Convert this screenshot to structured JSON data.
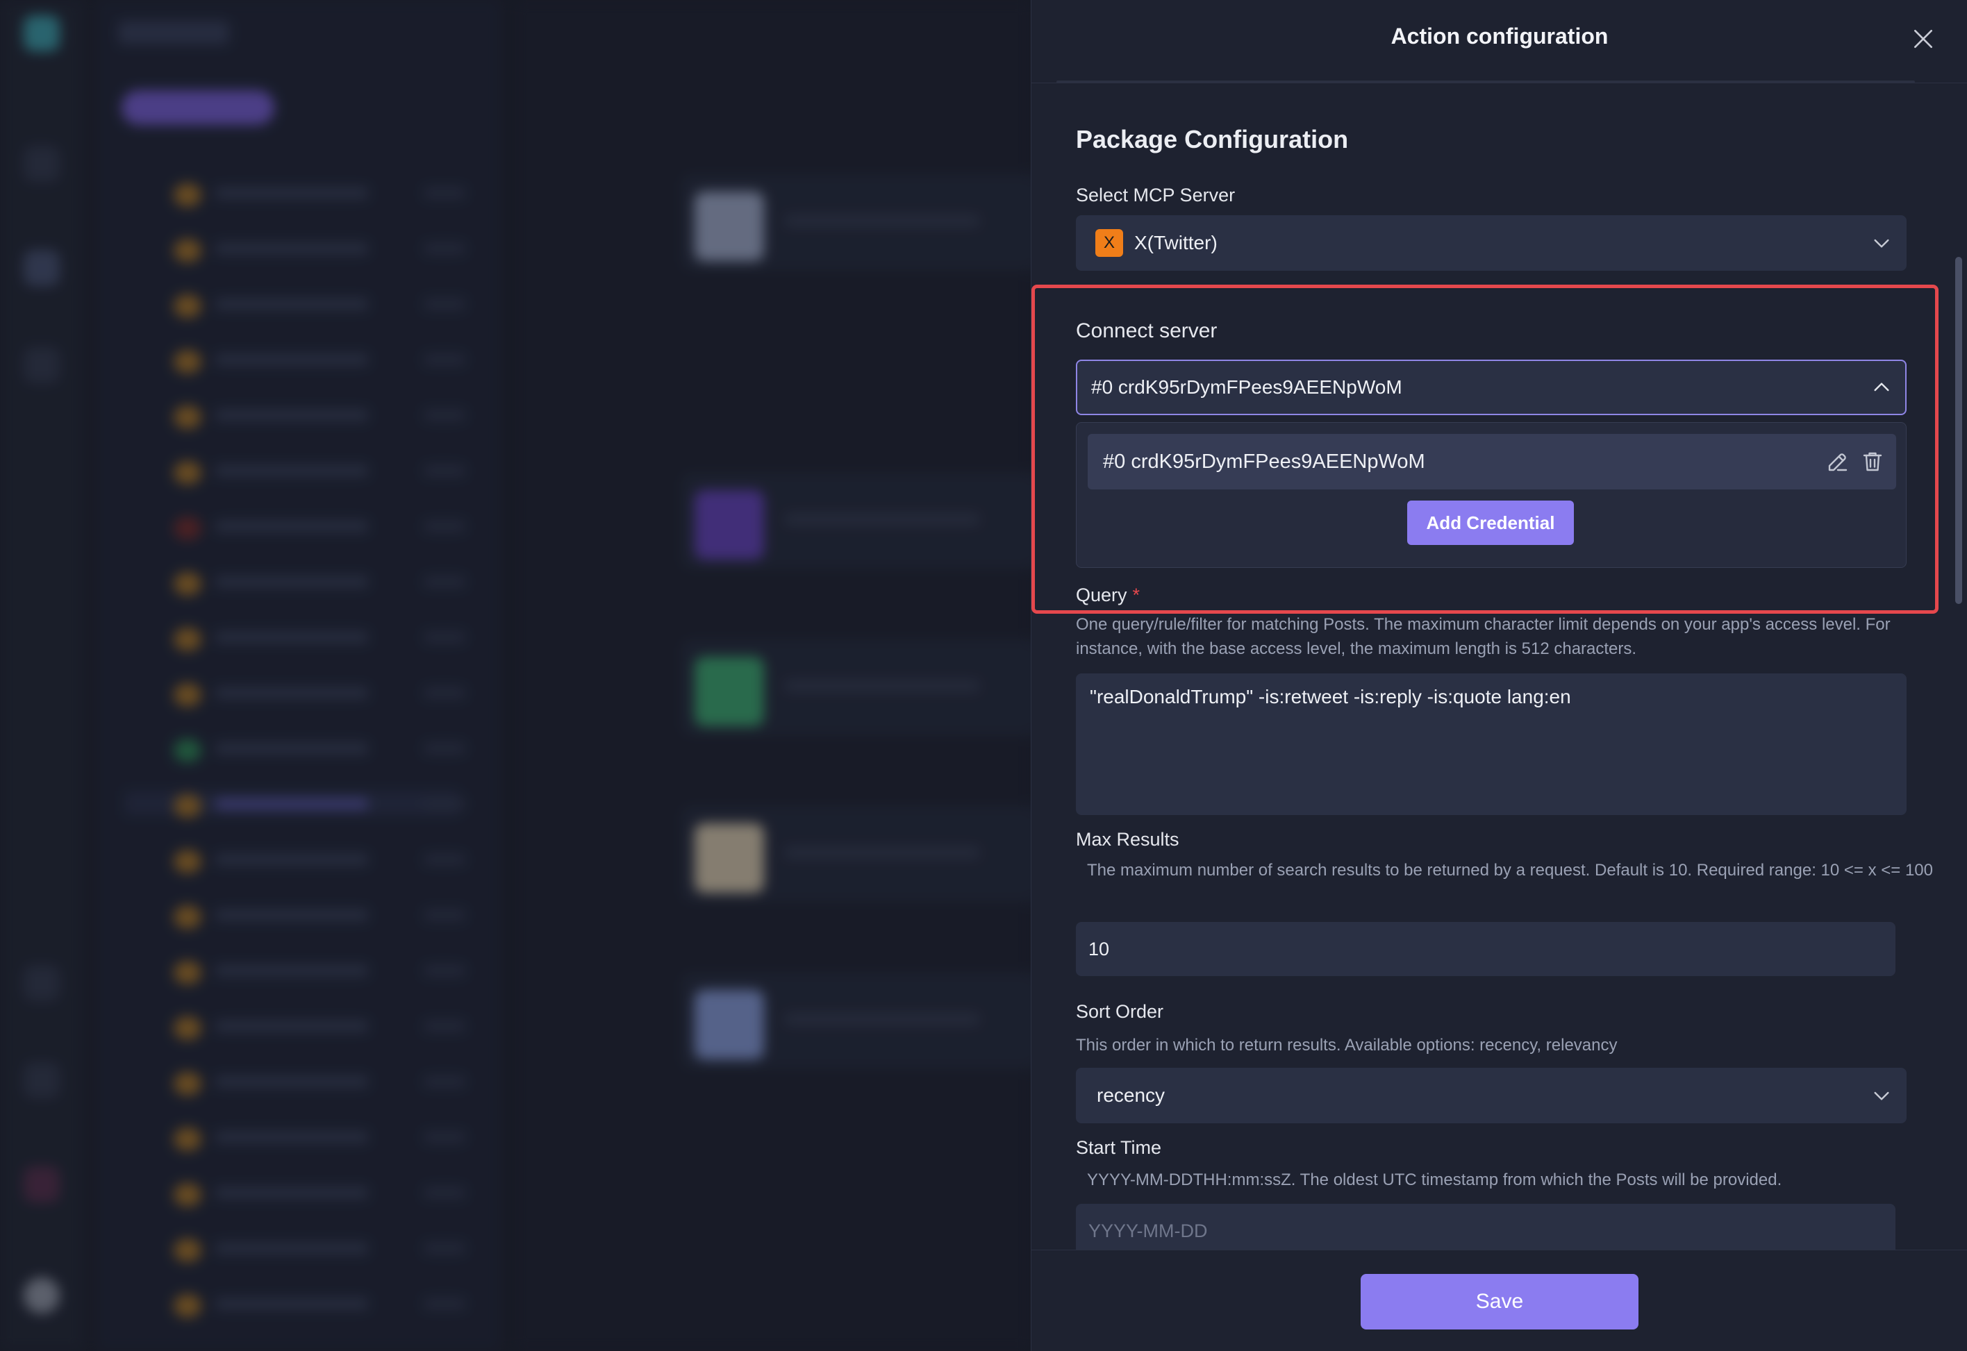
{
  "drawer": {
    "title": "Action configuration",
    "section_title": "Package Configuration"
  },
  "mcp_server": {
    "label": "Select MCP Server",
    "badge": "X",
    "value": "X(Twitter)"
  },
  "connect_server": {
    "label": "Connect server",
    "selected": "#0 crdK95rDymFPees9AEENpWoM",
    "options": [
      {
        "label": "#0 crdK95rDymFPees9AEENpWoM"
      }
    ],
    "add_credential_label": "Add Credential"
  },
  "query": {
    "label": "Query",
    "required_mark": "*",
    "help": "One query/rule/filter for matching Posts. The maximum character limit depends on your app's access level. For instance, with the base access level, the maximum length is 512 characters.",
    "value": "\"realDonaldTrump\" -is:retweet -is:reply -is:quote lang:en"
  },
  "max_results": {
    "label": "Max Results",
    "help": "The maximum number of search results to be returned by a request. Default is 10. Required range: 10 <= x <= 100",
    "value": "10"
  },
  "sort_order": {
    "label": "Sort Order",
    "help": "This order in which to return results. Available options: recency, relevancy",
    "value": "recency"
  },
  "start_time": {
    "label": "Start Time",
    "help": "YYYY-MM-DDTHH:mm:ssZ. The oldest UTC timestamp from which the Posts will be provided.",
    "placeholder": "YYYY-MM-DD"
  },
  "footer": {
    "save_label": "Save"
  },
  "colors": {
    "accent": "#8b7cf0",
    "highlight_border": "#e5484d",
    "x_badge": "#f07e19"
  }
}
